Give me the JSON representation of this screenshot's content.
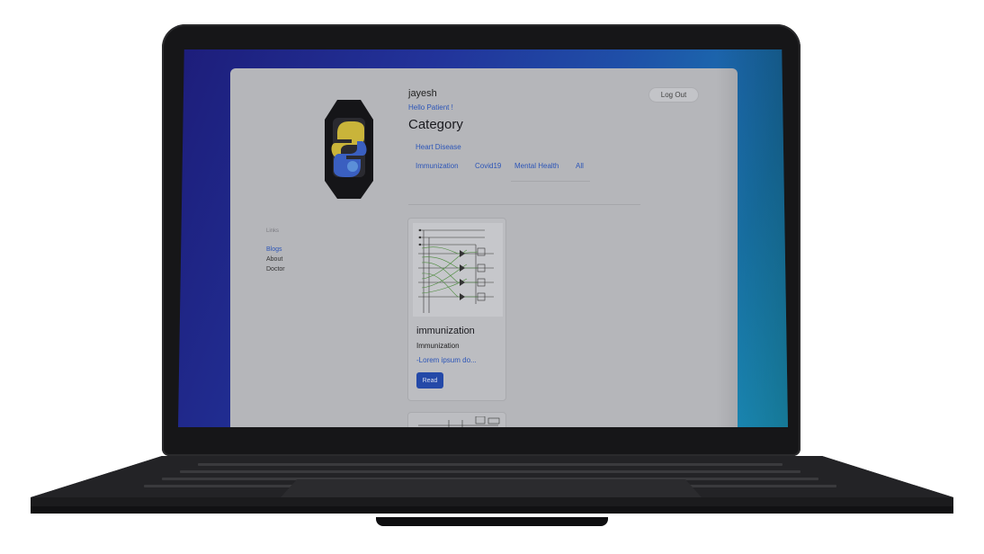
{
  "user": {
    "name": "jayesh",
    "greeting": "Hello Patient !"
  },
  "header": {
    "logout_label": "Log Out"
  },
  "category": {
    "title": "Category",
    "items": [
      "Heart Disease",
      "Immunization",
      "Covid19",
      "Mental Health",
      "All"
    ]
  },
  "sidebar": {
    "heading": "Links",
    "items": [
      {
        "label": "Blogs",
        "active": true
      },
      {
        "label": "About",
        "active": false
      },
      {
        "label": "Doctor",
        "active": false
      }
    ]
  },
  "cards": [
    {
      "title": "immunization",
      "subtitle": "Immunization",
      "excerpt": "-Lorem ipsum do...",
      "button": "Read"
    }
  ],
  "colors": {
    "accent_link": "#2c55b8",
    "button": "#2449a8",
    "screen_gradient_start": "#1d1d7a",
    "screen_gradient_end": "#1da0c8"
  }
}
